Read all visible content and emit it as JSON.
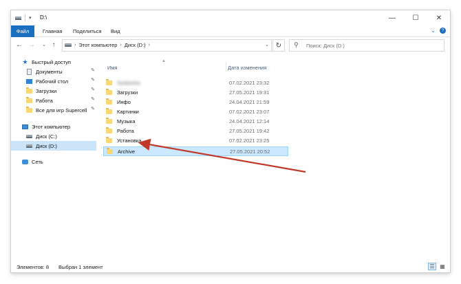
{
  "window": {
    "title": "D:\\",
    "controls": {
      "minimize": "—",
      "maximize": "☐",
      "close": "✕"
    }
  },
  "ribbon": {
    "tabs": [
      "Файл",
      "Главная",
      "Поделиться",
      "Вид"
    ],
    "expand_icon": "chevron-down-icon",
    "help_icon": "help-icon"
  },
  "address": {
    "path": [
      "Этот компьютер",
      "Диск (D:)"
    ],
    "search_placeholder": "Поиск: Диск (D:)"
  },
  "nav_pane": {
    "items": [
      {
        "label": "Быстрый доступ",
        "icon": "star-icon",
        "pinned": false,
        "selected": false
      },
      {
        "label": "Документы",
        "icon": "documents-icon",
        "pinned": true,
        "selected": false
      },
      {
        "label": "Рабочий стол",
        "icon": "desktop-icon",
        "pinned": true,
        "selected": false
      },
      {
        "label": "Загрузки",
        "icon": "folder-icon",
        "pinned": true,
        "selected": false
      },
      {
        "label": "Работа",
        "icon": "folder-icon",
        "pinned": true,
        "selected": false
      },
      {
        "label": "Все для игр Supercell",
        "icon": "folder-icon",
        "pinned": true,
        "selected": false
      },
      {
        "label": "Этот компьютер",
        "icon": "computer-icon",
        "pinned": false,
        "selected": false
      },
      {
        "label": "Диск (C:)",
        "icon": "drive-icon",
        "pinned": false,
        "selected": false
      },
      {
        "label": "Диск (D:)",
        "icon": "drive-icon",
        "pinned": false,
        "selected": true
      },
      {
        "label": "Сеть",
        "icon": "network-icon",
        "pinned": false,
        "selected": false
      }
    ]
  },
  "file_list": {
    "columns": {
      "name": "Имя",
      "date": "Дата изменения"
    },
    "rows": [
      {
        "name": "Sysbanha",
        "date": "07.02.2021 23:32",
        "blurred": true,
        "selected": false
      },
      {
        "name": "Загрузки",
        "date": "27.05.2021 19:31",
        "blurred": false,
        "selected": false
      },
      {
        "name": "Инфо",
        "date": "24.04.2021 21:59",
        "blurred": false,
        "selected": false
      },
      {
        "name": "Картинки",
        "date": "07.02.2021 23:07",
        "blurred": false,
        "selected": false
      },
      {
        "name": "Музыка",
        "date": "24.04.2021 12:14",
        "blurred": false,
        "selected": false
      },
      {
        "name": "Работа",
        "date": "27.05.2021 19:42",
        "blurred": false,
        "selected": false
      },
      {
        "name": "Установка",
        "date": "07.02.2021 23:25",
        "blurred": false,
        "selected": false
      },
      {
        "name": "Archive",
        "date": "27.05.2021 20:52",
        "blurred": false,
        "selected": true
      }
    ]
  },
  "status": {
    "items_count": "Элементов: 8",
    "selected": "Выбран 1 элемент"
  },
  "colors": {
    "accent": "#1a6fc0",
    "selection": "#cce8ff",
    "folder": "#f8d775",
    "annotation_arrow": "#c0392b"
  }
}
